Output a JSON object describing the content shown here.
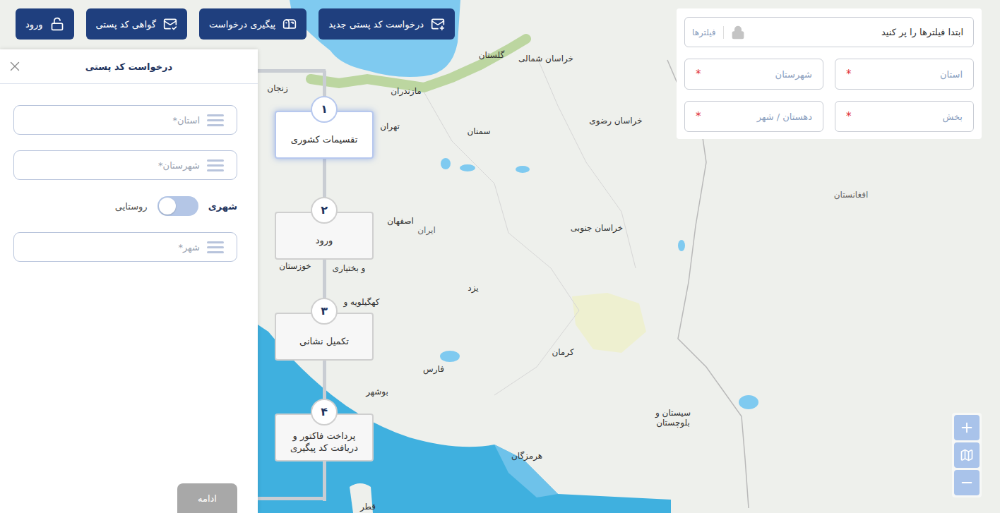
{
  "toolbar": {
    "buttons": [
      {
        "label": "درخواست کد پستی جدید",
        "icon": "new"
      },
      {
        "label": "پیگیری درخواست",
        "icon": "track"
      },
      {
        "label": "گواهی کد پستی",
        "icon": "certificate"
      },
      {
        "label": "ورود",
        "icon": "login"
      }
    ]
  },
  "panel": {
    "title": "درخواست کد پستی",
    "fields_top": [
      {
        "placeholder": "استان*"
      },
      {
        "placeholder": "شهرستان*"
      }
    ],
    "toggle": {
      "on_label": "شهری",
      "off_label": "روستایی",
      "on": true
    },
    "fields_bottom": [
      {
        "placeholder": "شهر*"
      }
    ],
    "continue_button": {
      "label": "ادامه",
      "disabled": true
    }
  },
  "steps": [
    {
      "number": "۱",
      "label": "تقسیمات کشوری",
      "selected": true
    },
    {
      "number": "۲",
      "label": "ورود",
      "selected": false
    },
    {
      "number": "۳",
      "label": "تکمیل نشانی",
      "selected": false
    },
    {
      "number": "۴",
      "label": "پرداخت فاکتور و دریافت کد پیگیری",
      "selected": false
    }
  ],
  "filters": {
    "search_placeholder": "ابتدا فیلترها را پر کنید",
    "filters_button": "فیلترها",
    "locked": true,
    "fields": [
      {
        "placeholder": "استان",
        "required_mark": "*"
      },
      {
        "placeholder": "شهرستان",
        "required_mark": "*"
      },
      {
        "placeholder": "بخش",
        "required_mark": "*"
      },
      {
        "placeholder": "دهستان / شهر",
        "required_mark": "*"
      }
    ]
  },
  "map": {
    "labels": [
      {
        "text": "گلستان"
      },
      {
        "text": "خراسان شمالی"
      },
      {
        "text": "زنجان"
      },
      {
        "text": "مازندران"
      },
      {
        "text": "خراسان رضوی"
      },
      {
        "text": "سمنان"
      },
      {
        "text": "اصفهان"
      },
      {
        "text": "ایران"
      },
      {
        "text": "خراسان جنوبی"
      },
      {
        "text": "خوزستان"
      },
      {
        "text": "و بختیاری"
      },
      {
        "text": "کهگیلویه و"
      },
      {
        "text": "یزد"
      },
      {
        "text": "افغانستان"
      },
      {
        "text": "کرمان"
      },
      {
        "text": "فارس"
      },
      {
        "text": "بوشهر"
      },
      {
        "text": "سیستان و بلوچستان"
      },
      {
        "text": "هرمزگان"
      },
      {
        "text": "قطر"
      },
      {
        "text": "تهران"
      }
    ]
  }
}
